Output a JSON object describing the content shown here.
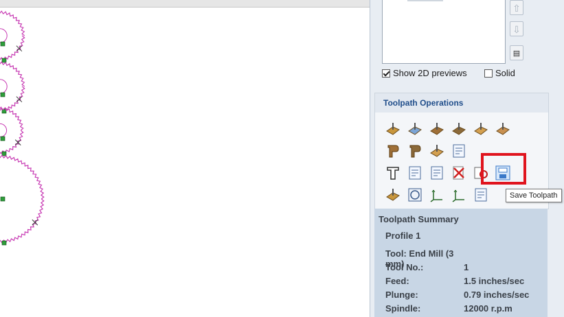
{
  "panel": {
    "show_previews_label": "Show 2D previews",
    "show_previews_checked": true,
    "solid_label": "Solid",
    "solid_checked": false
  },
  "ops": {
    "title": "Toolpath Operations",
    "icons": [
      [
        "profile-toolpath-icon",
        "pocket-toolpath-icon",
        "drill-toolpath-icon",
        "inlay-toolpath-icon",
        "vcarve-toolpath-icon",
        "texture-toolpath-icon"
      ],
      [
        "prism-carve-icon",
        "fluting-toolpath-icon",
        "moulding-toolpath-icon",
        "calculator-icon"
      ],
      [
        "text-engraving-icon",
        "gcode-edit-icon",
        "gcode-merge-icon",
        "delete-toolpath-icon",
        "stop-toolpath-icon",
        "save-toolpath-icon"
      ],
      [
        "material-setup-icon",
        "preview-toolpath-icon",
        "xyz-origin-icon",
        "zero-plane-icon",
        "export-toolpath-icon"
      ]
    ]
  },
  "tooltip": {
    "text": "Save Toolpath"
  },
  "summary": {
    "title": "Toolpath Summary",
    "operation": "Profile 1",
    "rows": [
      {
        "key": "Tool: End Mill (3 mm)",
        "value": ""
      },
      {
        "key": "Tool No.:",
        "value": "1"
      },
      {
        "key": "Feed:",
        "value": "1.5 inches/sec"
      },
      {
        "key": "Plunge:",
        "value": "0.79 inches/sec"
      },
      {
        "key": "Spindle:",
        "value": "12000 r.p.m"
      }
    ]
  },
  "colors": {
    "toolpath": "#c83cb4",
    "node": "#2e9e3a",
    "highlight": "#e0141e",
    "header_text": "#1f4d8a"
  }
}
